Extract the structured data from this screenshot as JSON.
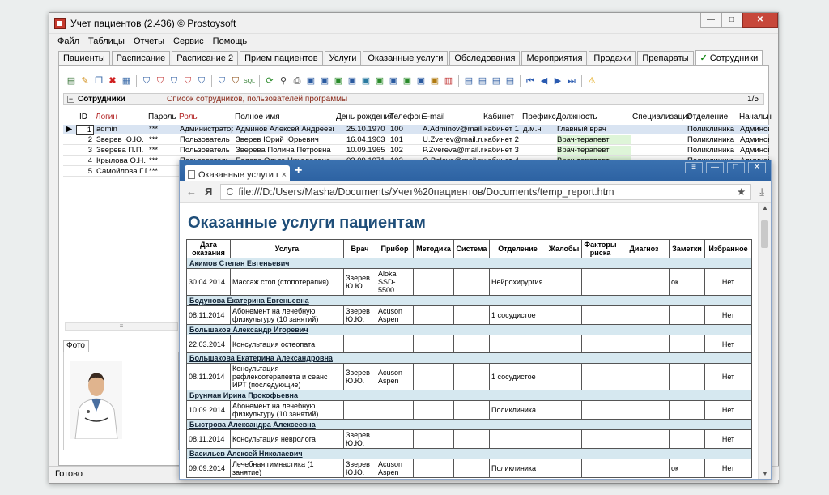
{
  "main_window": {
    "title": "Учет пациентов (2.436) © Prostoysoft",
    "minimize": "—",
    "maximize": "□",
    "close": "✕"
  },
  "menu": [
    "Файл",
    "Таблицы",
    "Отчеты",
    "Сервис",
    "Помощь"
  ],
  "tabs": [
    "Пациенты",
    "Расписание",
    "Расписание 2",
    "Прием пациентов",
    "Услуги",
    "Оказанные услуги",
    "Обследования",
    "Мероприятия",
    "Продажи",
    "Препараты",
    "Сотрудники"
  ],
  "toolbar_icons": [
    "report-icon",
    "edit-icon",
    "copy-icon",
    "delete-icon",
    "filter-icon",
    "filter-add-icon",
    "filter-clear-icon",
    "filter-edit-icon",
    "sort-icon",
    "sql-icon",
    "refresh-icon",
    "binoculars-icon",
    "print-icon",
    "preview-icon",
    "export-icon",
    "excel-icon",
    "word-icon",
    "html-icon",
    "chart-icon",
    "ruler-icon",
    "settings-icon",
    "first-icon",
    "prev-icon",
    "next-icon",
    "last-icon",
    "warning-icon"
  ],
  "grid": {
    "title": "Сотрудники",
    "description": "Список сотрудников, пользователей программы",
    "counter": "1/5",
    "columns": [
      "ID",
      "Логин",
      "Пароль",
      "Роль",
      "Полное имя",
      "День рождения",
      "Телефон",
      "E-mail",
      "Кабинет",
      "Префикс",
      "Должность",
      "Специализация",
      "Отделение",
      "Начальн"
    ],
    "rows": [
      {
        "id": "1",
        "login": "admin",
        "pwd": "***",
        "role": "Администратор",
        "name": "Админов Алексей Андреевич",
        "bday": "25.10.1970",
        "phone": "100",
        "email": "A.Adminov@mail.ru",
        "room": "кабинет 1",
        "prefix": "д.м.н",
        "position": "Главный врач",
        "spec": "",
        "dept": "Поликлиника",
        "chief": "Админов"
      },
      {
        "id": "2",
        "login": "Зверев Ю.Ю.",
        "pwd": "***",
        "role": "Пользователь",
        "name": "Зверев Юрий Юрьевич",
        "bday": "16.04.1963",
        "phone": "101",
        "email": "U.Zverev@mail.ru",
        "room": "кабинет 2",
        "prefix": "",
        "position": "Врач-терапевт",
        "spec": "",
        "dept": "Поликлиника",
        "chief": "Админов"
      },
      {
        "id": "3",
        "login": "Зверева П.П.",
        "pwd": "***",
        "role": "Пользователь",
        "name": "Зверева Полина Петровна",
        "bday": "10.09.1965",
        "phone": "102",
        "email": "P.Zvereva@mail.ru",
        "room": "кабинет 3",
        "prefix": "",
        "position": "Врач-терапевт",
        "spec": "",
        "dept": "Поликлиника",
        "chief": "Админов"
      },
      {
        "id": "4",
        "login": "Крылова О.Н.",
        "pwd": "***",
        "role": "Пользователь",
        "name": "Белова Ольга Николаевна",
        "bday": "02.09.1971",
        "phone": "103",
        "email": "O.Belova@mail.ru",
        "room": "кабинет 4",
        "prefix": "",
        "position": "Врач-терапевт",
        "spec": "",
        "dept": "Поликлиника",
        "chief": "Админов"
      },
      {
        "id": "5",
        "login": "Самойлова Г.Г.",
        "pwd": "***",
        "role": "",
        "name": "",
        "bday": "",
        "phone": "",
        "email": "",
        "room": "",
        "prefix": "",
        "position": "",
        "spec": "",
        "dept": "",
        "chief": ""
      }
    ]
  },
  "photo_tab": "Фото",
  "status_text": "Готово",
  "browser": {
    "tab_title": "Оказанные услуги па",
    "tab_close": "×",
    "new_tab": "+",
    "back": "←",
    "yandex": "Я",
    "reload": "C",
    "url": "file:///D:/Users/Masha/Documents/Учет%20пациентов/Documents/temp_report.htm",
    "star": "★",
    "download": "⤓",
    "report": {
      "heading": "Оказанные услуги пациентам",
      "columns": [
        "Дата оказания",
        "Услуга",
        "Врач",
        "Прибор",
        "Методика",
        "Система",
        "Отделение",
        "Жалобы",
        "Факторы риска",
        "Диагноз",
        "Заметки",
        "Избранное"
      ],
      "groups": [
        {
          "patient": "Акимов Степан Евгеньевич",
          "rows": [
            {
              "date": "30.04.2014",
              "service": "Массаж стоп (стопотерапия)",
              "doctor": "Зверев Ю.Ю.",
              "device": "Aloka SSD-5500",
              "method": "",
              "system": "",
              "dept": "Нейрохирургия",
              "compl": "",
              "risk": "",
              "diag": "",
              "notes": "ок",
              "fav": "Нет"
            }
          ]
        },
        {
          "patient": "Бодунова Екатерина Евгеньевна",
          "rows": [
            {
              "date": "08.11.2014",
              "service": "Абонемент на лечебную физкультуру (10 занятий)",
              "doctor": "Зверев Ю.Ю.",
              "device": "Acuson Aspen",
              "method": "",
              "system": "",
              "dept": "1 сосудистое",
              "compl": "",
              "risk": "",
              "diag": "",
              "notes": "",
              "fav": "Нет"
            }
          ]
        },
        {
          "patient": "Большаков Александр Игоревич",
          "rows": [
            {
              "date": "22.03.2014",
              "service": "Консультация остеопата",
              "doctor": "",
              "device": "",
              "method": "",
              "system": "",
              "dept": "",
              "compl": "",
              "risk": "",
              "diag": "",
              "notes": "",
              "fav": "Нет"
            }
          ]
        },
        {
          "patient": "Большакова Екатерина Александровна",
          "rows": [
            {
              "date": "08.11.2014",
              "service": "Консультация рефлексотерапевта и сеанс ИРТ (последующие)",
              "doctor": "Зверев Ю.Ю.",
              "device": "Acuson Aspen",
              "method": "",
              "system": "",
              "dept": "1 сосудистое",
              "compl": "",
              "risk": "",
              "diag": "",
              "notes": "",
              "fav": "Нет"
            }
          ]
        },
        {
          "patient": "Брунман Ирина Прокофьевна",
          "rows": [
            {
              "date": "10.09.2014",
              "service": "Абонемент на лечебную физкультуру (10 занятий)",
              "doctor": "",
              "device": "",
              "method": "",
              "system": "",
              "dept": "Поликлиника",
              "compl": "",
              "risk": "",
              "diag": "",
              "notes": "",
              "fav": "Нет"
            }
          ]
        },
        {
          "patient": "Быстрова Александра Алексеевна",
          "rows": [
            {
              "date": "08.11.2014",
              "service": "Консультация невролога",
              "doctor": "Зверев Ю.Ю.",
              "device": "",
              "method": "",
              "system": "",
              "dept": "",
              "compl": "",
              "risk": "",
              "diag": "",
              "notes": "",
              "fav": "Нет"
            }
          ]
        },
        {
          "patient": "Васильев Алексей Николаевич",
          "rows": [
            {
              "date": "09.09.2014",
              "service": "Лечебная гимнастика (1 занятие)",
              "doctor": "Зверев Ю.Ю.",
              "device": "Acuson Aspen",
              "method": "",
              "system": "",
              "dept": "Поликлиника",
              "compl": "",
              "risk": "",
              "diag": "",
              "notes": "ок",
              "fav": "Нет"
            }
          ]
        }
      ]
    }
  }
}
